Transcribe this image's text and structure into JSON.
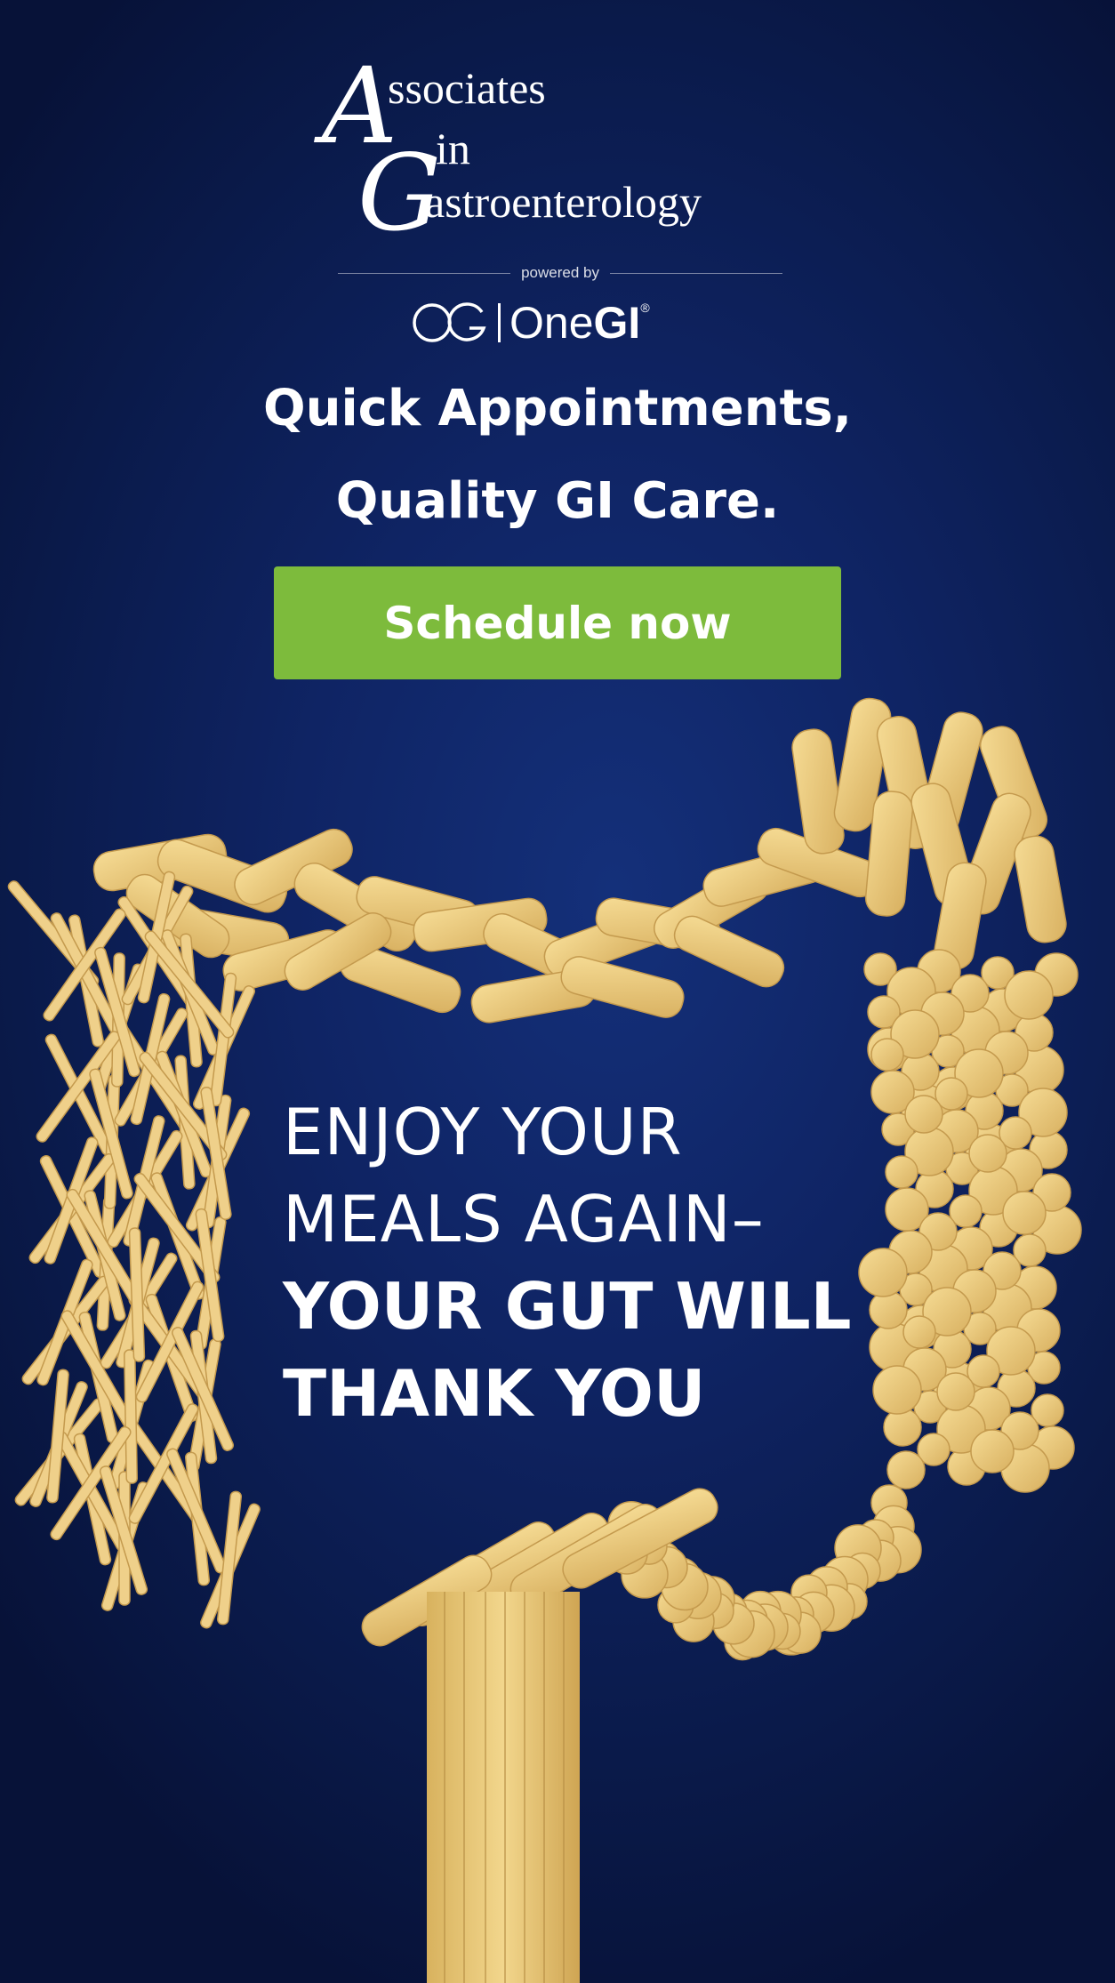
{
  "brand": {
    "logo_line1": "ssociates",
    "logo_line2": "in",
    "logo_line3": "astroenterology",
    "logo_initial_a": "A",
    "logo_initial_g": "G",
    "powered_by": "powered by",
    "partner_prefix": "One",
    "partner_suffix": "GI",
    "partner_reg": "®"
  },
  "headline": {
    "line1": "Quick Appointments,",
    "line2": "Quality GI Care."
  },
  "cta": {
    "label": "Schedule now"
  },
  "tagline": {
    "line1": "ENJOY YOUR",
    "line2": "MEALS AGAIN–",
    "line3": "YOUR GUT WILL",
    "line4": "THANK YOU"
  },
  "colors": {
    "background": "#0f2464",
    "cta": "#7dbb3c",
    "pasta": "#e9c879",
    "text": "#ffffff"
  },
  "icons": {
    "brand_mark": "og-monogram-icon",
    "illustration": "pasta-colon-illustration"
  }
}
